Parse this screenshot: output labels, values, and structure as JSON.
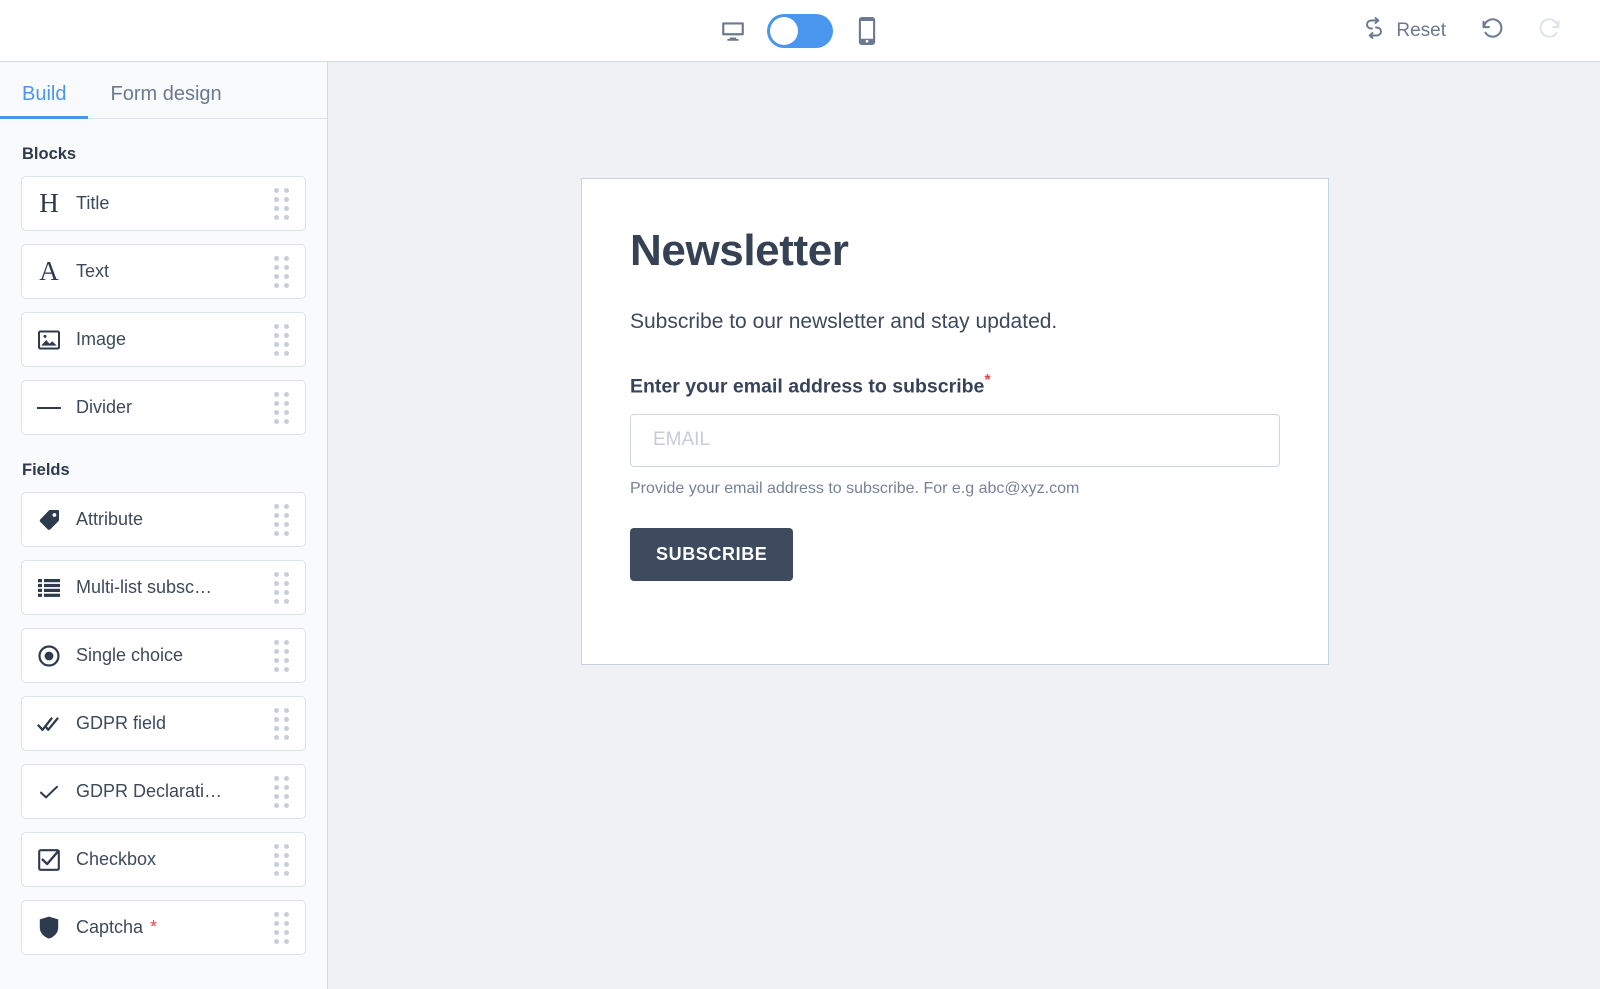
{
  "topbar": {
    "desktop_icon": "desktop-monitor-icon",
    "mobile_icon": "mobile-phone-icon",
    "toggle_state": "desktop",
    "reset_label": "Reset",
    "reset_icon": "swap-arrows-icon",
    "undo_icon": "undo-arrow-icon",
    "redo_icon": "redo-arrow-icon",
    "accent_blue": "#4a96ef"
  },
  "sidebar": {
    "tabs": [
      {
        "label": "Build",
        "active": true
      },
      {
        "label": "Form design",
        "active": false
      }
    ],
    "sections": [
      {
        "title": "Blocks",
        "items": [
          {
            "label": "Title",
            "icon": "heading-h-icon",
            "required": false
          },
          {
            "label": "Text",
            "icon": "text-a-icon",
            "required": false
          },
          {
            "label": "Image",
            "icon": "image-picture-icon",
            "required": false
          },
          {
            "label": "Divider",
            "icon": "divider-line-icon",
            "required": false
          }
        ]
      },
      {
        "title": "Fields",
        "items": [
          {
            "label": "Attribute",
            "icon": "tag-attribute-icon",
            "required": false
          },
          {
            "label": "Multi-list subsc…",
            "icon": "list-lines-icon",
            "required": false
          },
          {
            "label": "Single choice",
            "icon": "radio-button-icon",
            "required": false
          },
          {
            "label": "GDPR field",
            "icon": "double-check-icon",
            "required": false
          },
          {
            "label": "GDPR Declarati…",
            "icon": "check-icon",
            "required": false
          },
          {
            "label": "Checkbox",
            "icon": "checkbox-checked-icon",
            "required": false
          },
          {
            "label": "Captcha",
            "icon": "shield-icon",
            "required": true,
            "required_mark": "*"
          }
        ]
      }
    ]
  },
  "form": {
    "title": "Newsletter",
    "subtitle": "Subscribe to our newsletter and stay updated.",
    "email_label": "Enter your email address to subscribe",
    "email_required_mark": "*",
    "email_value": "",
    "email_placeholder": "EMAIL",
    "help_text": "Provide your email address to subscribe. For e.g abc@xyz.com",
    "submit_label": "SUBSCRIBE",
    "submit_color": "#3e4a5d"
  }
}
